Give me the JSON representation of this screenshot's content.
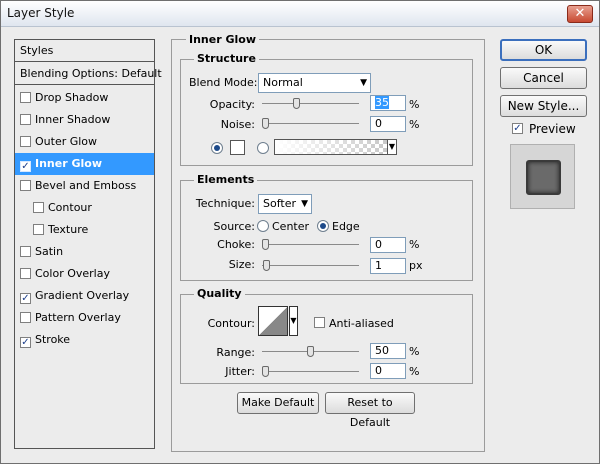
{
  "window": {
    "title": "Layer Style",
    "close_glyph": "✕"
  },
  "styles_panel": {
    "header": "Styles",
    "blending": "Blending Options: Default",
    "items": [
      {
        "label": "Drop Shadow",
        "checked": false
      },
      {
        "label": "Inner Shadow",
        "checked": false
      },
      {
        "label": "Outer Glow",
        "checked": false
      },
      {
        "label": "Inner Glow",
        "checked": true,
        "selected": true
      },
      {
        "label": "Bevel and Emboss",
        "checked": false
      },
      {
        "label": "Contour",
        "checked": false
      },
      {
        "label": "Texture",
        "checked": false
      },
      {
        "label": "Satin",
        "checked": false
      },
      {
        "label": "Color Overlay",
        "checked": false
      },
      {
        "label": "Gradient Overlay",
        "checked": true
      },
      {
        "label": "Pattern Overlay",
        "checked": false
      },
      {
        "label": "Stroke",
        "checked": true
      }
    ],
    "check_glyph": "✓"
  },
  "inner_glow": {
    "title": "Inner Glow",
    "structure": {
      "title": "Structure",
      "blend_mode_label": "Blend Mode:",
      "blend_mode_value": "Normal",
      "opacity_label": "Opacity:",
      "opacity_value": "35",
      "opacity_level": 0.35,
      "noise_label": "Noise:",
      "noise_value": "0",
      "noise_level": 0,
      "unit_percent": "%"
    },
    "elements": {
      "title": "Elements",
      "technique_label": "Technique:",
      "technique_value": "Softer",
      "source_label": "Source:",
      "source_center": "Center",
      "source_edge": "Edge",
      "source_selected": "Edge",
      "choke_label": "Choke:",
      "choke_value": "0",
      "choke_level": 0,
      "size_label": "Size:",
      "size_value": "1",
      "size_level": 0.01,
      "unit_px": "px"
    },
    "quality": {
      "title": "Quality",
      "contour_label": "Contour:",
      "anti_aliased_label": "Anti-aliased",
      "anti_aliased_checked": false,
      "range_label": "Range:",
      "range_value": "50",
      "range_level": 0.5,
      "jitter_label": "Jitter:",
      "jitter_value": "0",
      "jitter_level": 0
    },
    "make_default": "Make Default",
    "reset_default": "Reset to Default"
  },
  "buttons": {
    "ok": "OK",
    "cancel": "Cancel",
    "new_style": "New Style..."
  },
  "preview": {
    "label": "Preview",
    "checked": true
  },
  "dropdown_glyph": "▼"
}
